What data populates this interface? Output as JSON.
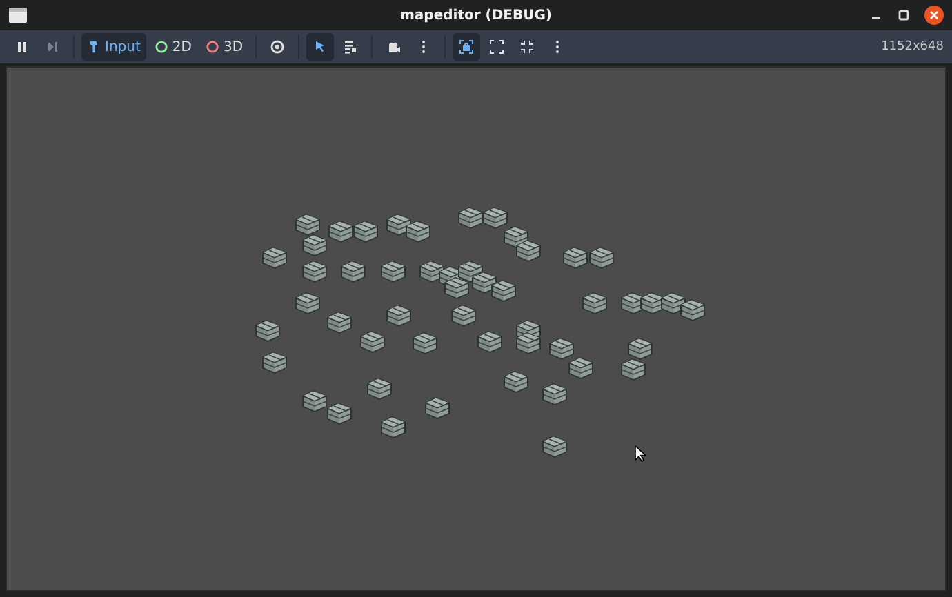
{
  "window": {
    "title": "mapeditor (DEBUG)"
  },
  "toolbar": {
    "items": [
      {
        "kind": "pause",
        "selected": false,
        "disabled": false
      },
      {
        "kind": "step",
        "selected": false,
        "disabled": true
      },
      {
        "kind": "sep"
      },
      {
        "kind": "input",
        "label": "Input",
        "selected": true,
        "disabled": false
      },
      {
        "kind": "planar",
        "label": "2D",
        "selected": false,
        "disabled": false
      },
      {
        "kind": "spatial",
        "label": "3D",
        "selected": false,
        "disabled": false
      },
      {
        "kind": "sep"
      },
      {
        "kind": "eye",
        "selected": false,
        "disabled": false
      },
      {
        "kind": "sep"
      },
      {
        "kind": "select",
        "selected": true,
        "disabled": false
      },
      {
        "kind": "list",
        "selected": false,
        "disabled": false
      },
      {
        "kind": "sep"
      },
      {
        "kind": "camera",
        "selected": false,
        "disabled": false
      },
      {
        "kind": "more",
        "selected": false,
        "disabled": false
      },
      {
        "kind": "sep"
      },
      {
        "kind": "lock",
        "selected": true,
        "disabled": false
      },
      {
        "kind": "expand",
        "selected": false,
        "disabled": false
      },
      {
        "kind": "shrink",
        "selected": false,
        "disabled": false
      },
      {
        "kind": "more",
        "selected": false,
        "disabled": false
      }
    ],
    "resolution": "1152x648"
  }
}
